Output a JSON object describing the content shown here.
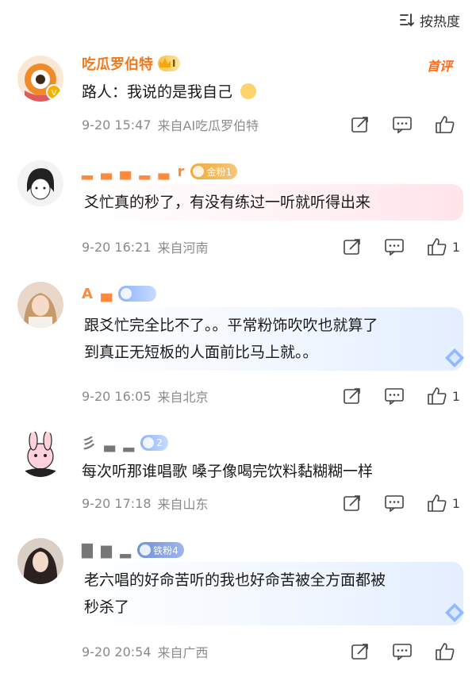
{
  "sort": {
    "label": "按热度"
  },
  "comments": [
    {
      "username": "吃瓜罗伯特",
      "level_badge": "I",
      "first_tag": "首评",
      "text": "路人：我说的是我自己",
      "time": "9-20 15:47",
      "source": "来自AI吃瓜罗伯特",
      "likes": ""
    },
    {
      "username": "▂ ▃ ▄ ▂ ▃ r",
      "fan_badge": "金粉1",
      "text": "爻忙真的秒了，有没有练过一听就听得出来",
      "time": "9-20 16:21",
      "source": "来自河南",
      "likes": "1"
    },
    {
      "username": "A ▄",
      "text_lines": [
        "跟爻忙完全比不了。。平常粉饰吹吹也就算了",
        "到真正无短板的人面前比马上就。。"
      ],
      "time": "9-20 16:05",
      "source": "来自北京",
      "likes": "1"
    },
    {
      "username": "彡 ▃ ▂",
      "fan_badge": "2",
      "text": "每次听那谁唱歌 嗓子像喝完饮料黏糊糊一样",
      "time": "9-20 17:18",
      "source": "来自山东",
      "likes": "1"
    },
    {
      "username": "▇ ▆ ▂",
      "fan_badge": "铁粉4",
      "text_lines": [
        "老六唱的好命苦听的我也好命苦被全方面都被",
        "秒杀了"
      ],
      "time": "9-20 20:54",
      "source": "来自广西",
      "likes": ""
    }
  ],
  "colors": {
    "username": "#f07a1d",
    "meta": "#8a8a8a",
    "first_tag": "#ff6a1a"
  },
  "icons": [
    "sort-icon",
    "share-icon",
    "comment-icon",
    "like-icon",
    "diamond-icon",
    "crown-icon"
  ]
}
